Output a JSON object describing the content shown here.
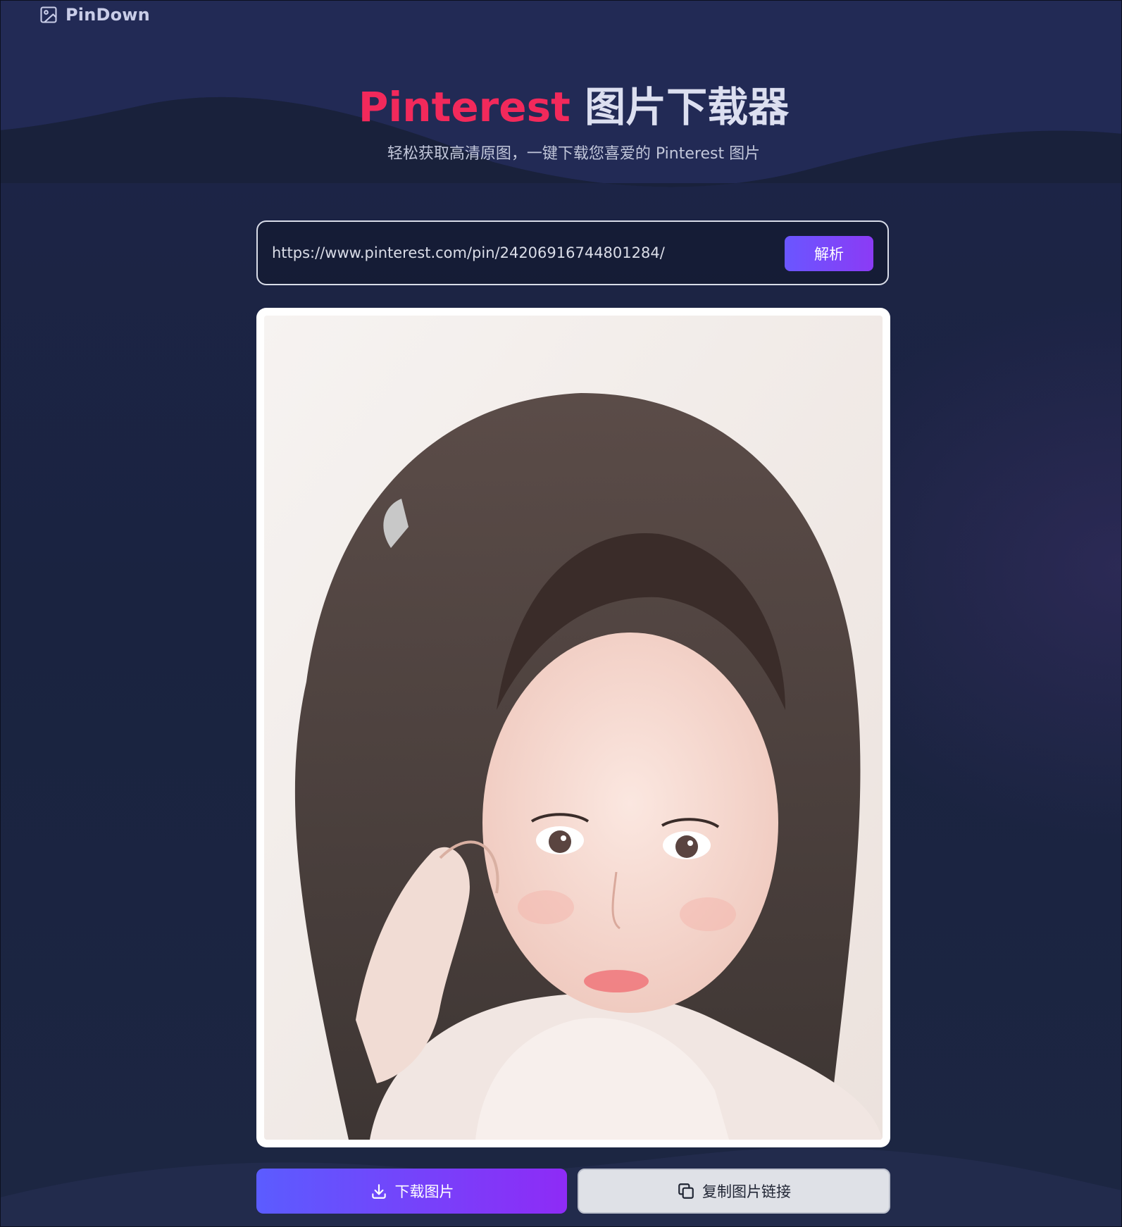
{
  "app": {
    "name": "PinDown",
    "logo_icon": "image-icon"
  },
  "hero": {
    "title_brand": "Pinterest",
    "title_rest": "图片下载器",
    "subtitle": "轻松获取高清原图，一键下载您喜爱的 Pinterest 图片"
  },
  "search": {
    "value": "https://www.pinterest.com/pin/24206916744801284/",
    "button_label": "解析"
  },
  "result": {
    "image_alt": "Illustrated portrait of a young woman with long dark wavy hair in a white knit sweater, resting her chin on her hand"
  },
  "actions": {
    "download_label": "下载图片",
    "download_icon": "download-icon",
    "copy_label": "复制图片链接",
    "copy_icon": "copy-icon"
  },
  "colors": {
    "background": "#1b2440",
    "title_accent": "#f2295b",
    "button_gradient_start": "#5b5cff",
    "button_gradient_end": "#8e2bf6",
    "secondary_button": "#dfe1e7"
  }
}
